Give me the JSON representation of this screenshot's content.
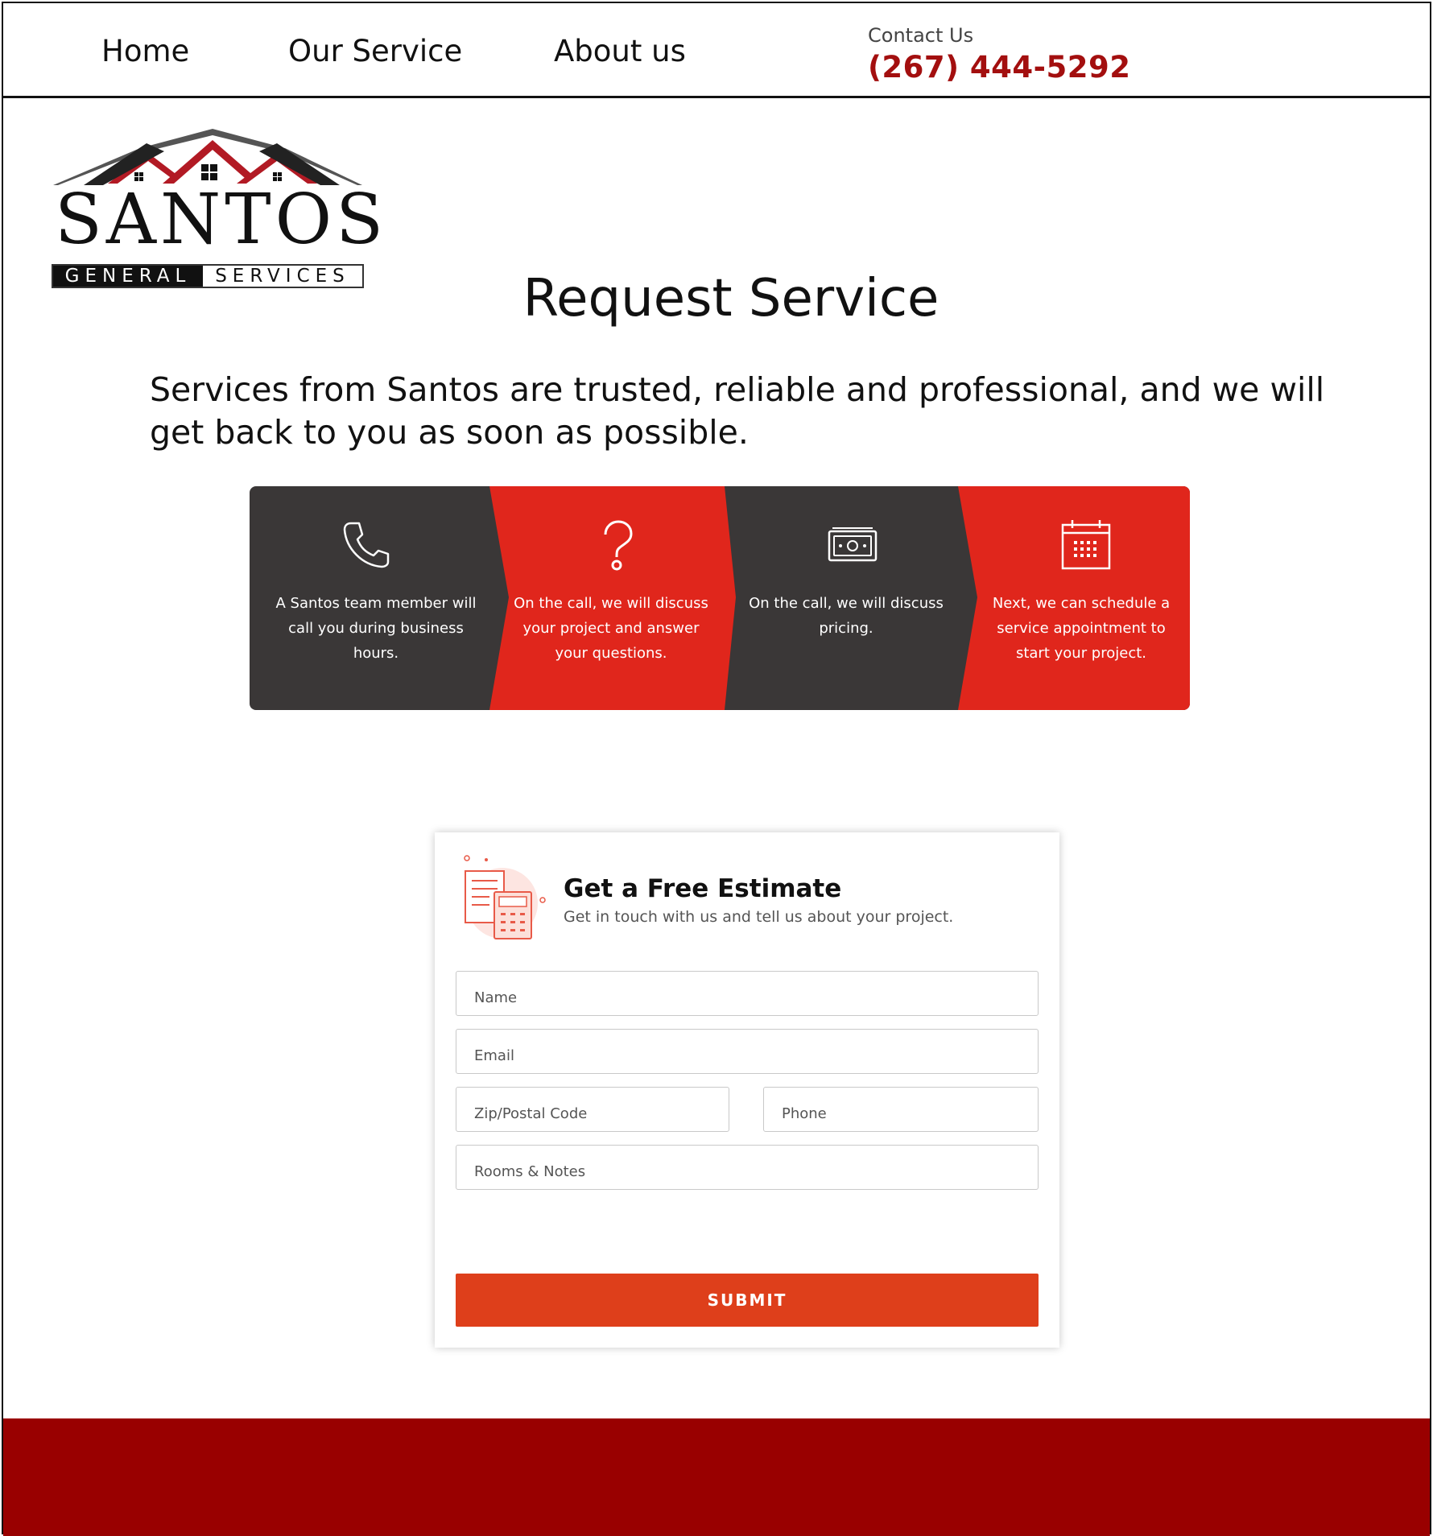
{
  "nav": {
    "items": [
      {
        "label": "Home"
      },
      {
        "label": "Our Service"
      },
      {
        "label": "About us"
      }
    ],
    "contact_label": "Contact Us",
    "contact_phone": "(267) 444-5292"
  },
  "logo": {
    "word": "SANTOS",
    "sub_left": "GENERAL",
    "sub_right": "SERVICES"
  },
  "page": {
    "title": "Request Service",
    "intro": "Services from Santos are trusted, reliable and professional, and we will get back to you as soon as possible."
  },
  "steps": [
    {
      "icon": "phone-icon",
      "text": "A Santos team member will call you during business hours."
    },
    {
      "icon": "question-icon",
      "text": "On the call, we will discuss your project and answer your questions."
    },
    {
      "icon": "money-icon",
      "text": "On the call, we will discuss pricing."
    },
    {
      "icon": "calendar-icon",
      "text": "Next, we can schedule a service appointment to start your project."
    }
  ],
  "form": {
    "title": "Get a Free Estimate",
    "subtitle": "Get in touch with us and tell us about your project.",
    "name_placeholder": "Name",
    "email_placeholder": "Email",
    "zip_placeholder": "Zip/Postal Code",
    "phone_placeholder": "Phone",
    "notes_placeholder": "Rooms & Notes",
    "submit_label": "SUBMIT"
  },
  "colors": {
    "brand_red": "#a30f0f",
    "banner_red": "#e0261c",
    "banner_dark": "#3a3737",
    "submit": "#de3f1b",
    "footer": "#990000"
  }
}
